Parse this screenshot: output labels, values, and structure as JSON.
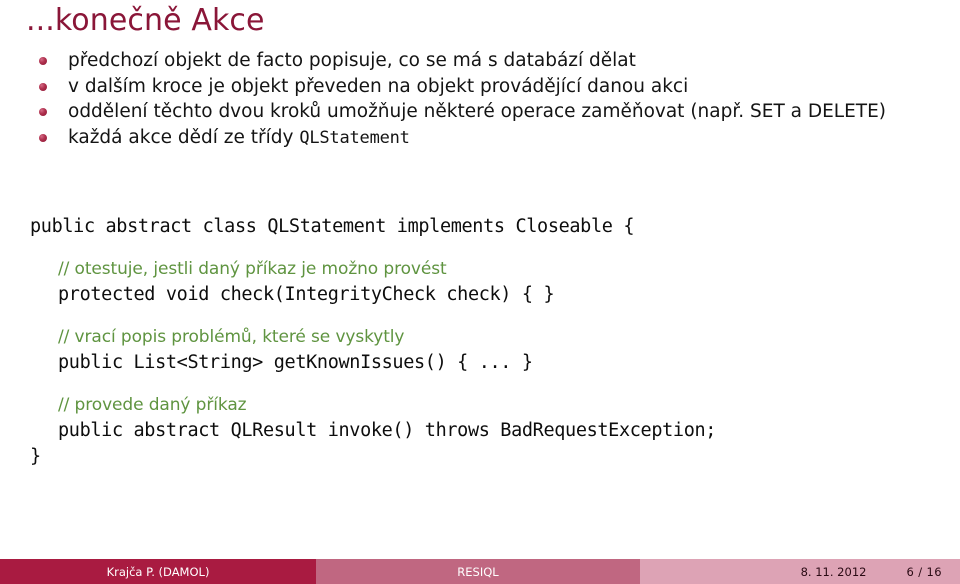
{
  "slide": {
    "title": "...konečně Akce",
    "bullets": [
      {
        "text": "předchozí objekt de facto popisuje, co se má s databází dělat"
      },
      {
        "text": "v dalším kroce je objekt převeden na objekt provádějící danou akci"
      },
      {
        "text": "oddělení těchto dvou kroků umožňuje některé operace zaměňovat (např. SET a DELETE)"
      },
      {
        "text_before": "každá akce dědí ze třídy ",
        "mono": "QLStatement",
        "text_after": ""
      }
    ],
    "code": [
      {
        "kind": "code",
        "text": "public abstract class QLStatement implements Closeable {"
      },
      {
        "kind": "spacer",
        "text": ""
      },
      {
        "kind": "comment",
        "text": "// otestuje, jestli daný příkaz je možno provést"
      },
      {
        "kind": "code-indent",
        "text": "protected void check(IntegrityCheck check) { }"
      },
      {
        "kind": "spacer-sm",
        "text": ""
      },
      {
        "kind": "comment",
        "text": "// vrací popis problémů, které se vyskytly"
      },
      {
        "kind": "code-indent",
        "text": "public List<String> getKnownIssues() { ... }"
      },
      {
        "kind": "spacer-sm",
        "text": ""
      },
      {
        "kind": "comment",
        "text": "// provede daný příkaz"
      },
      {
        "kind": "code-indent",
        "text": "public abstract QLResult invoke() throws BadRequestException;"
      },
      {
        "kind": "code",
        "text": "}"
      }
    ]
  },
  "footer": {
    "author": "Krajča P.  (DAMOL)",
    "talk": "RESIQL",
    "date": "8. 11. 2012",
    "page": "6 / 16"
  },
  "colors": {
    "title": "#8a1638",
    "bullet": "#a8284a",
    "comment": "#5f9440",
    "footer_left_bg": "#a91b41",
    "footer_mid_bg": "#c06781",
    "footer_right_bg": "#dda3b5"
  }
}
